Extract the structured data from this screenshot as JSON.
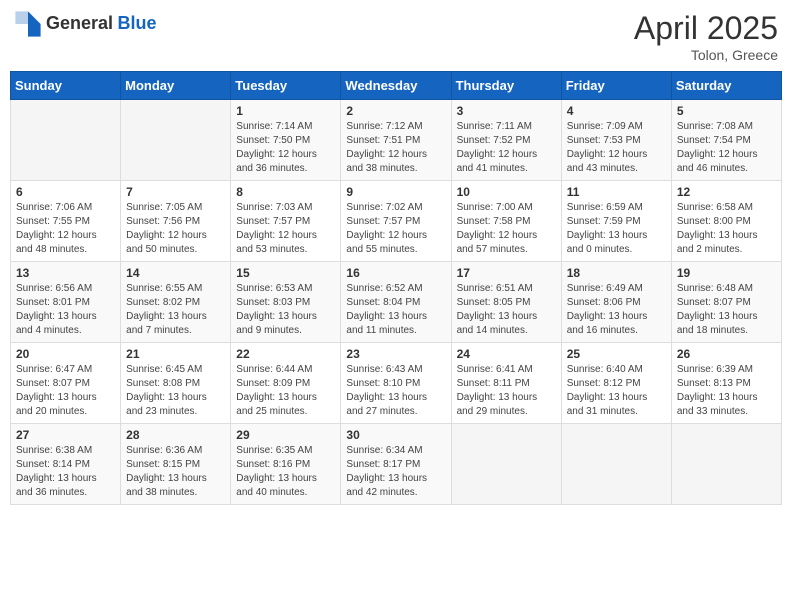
{
  "header": {
    "logo_general": "General",
    "logo_blue": "Blue",
    "month": "April 2025",
    "location": "Tolon, Greece"
  },
  "days_of_week": [
    "Sunday",
    "Monday",
    "Tuesday",
    "Wednesday",
    "Thursday",
    "Friday",
    "Saturday"
  ],
  "weeks": [
    [
      {
        "day": "",
        "sunrise": "",
        "sunset": "",
        "daylight": "",
        "empty": true
      },
      {
        "day": "",
        "sunrise": "",
        "sunset": "",
        "daylight": "",
        "empty": true
      },
      {
        "day": "1",
        "sunrise": "Sunrise: 7:14 AM",
        "sunset": "Sunset: 7:50 PM",
        "daylight": "Daylight: 12 hours and 36 minutes.",
        "empty": false
      },
      {
        "day": "2",
        "sunrise": "Sunrise: 7:12 AM",
        "sunset": "Sunset: 7:51 PM",
        "daylight": "Daylight: 12 hours and 38 minutes.",
        "empty": false
      },
      {
        "day": "3",
        "sunrise": "Sunrise: 7:11 AM",
        "sunset": "Sunset: 7:52 PM",
        "daylight": "Daylight: 12 hours and 41 minutes.",
        "empty": false
      },
      {
        "day": "4",
        "sunrise": "Sunrise: 7:09 AM",
        "sunset": "Sunset: 7:53 PM",
        "daylight": "Daylight: 12 hours and 43 minutes.",
        "empty": false
      },
      {
        "day": "5",
        "sunrise": "Sunrise: 7:08 AM",
        "sunset": "Sunset: 7:54 PM",
        "daylight": "Daylight: 12 hours and 46 minutes.",
        "empty": false
      }
    ],
    [
      {
        "day": "6",
        "sunrise": "Sunrise: 7:06 AM",
        "sunset": "Sunset: 7:55 PM",
        "daylight": "Daylight: 12 hours and 48 minutes.",
        "empty": false
      },
      {
        "day": "7",
        "sunrise": "Sunrise: 7:05 AM",
        "sunset": "Sunset: 7:56 PM",
        "daylight": "Daylight: 12 hours and 50 minutes.",
        "empty": false
      },
      {
        "day": "8",
        "sunrise": "Sunrise: 7:03 AM",
        "sunset": "Sunset: 7:57 PM",
        "daylight": "Daylight: 12 hours and 53 minutes.",
        "empty": false
      },
      {
        "day": "9",
        "sunrise": "Sunrise: 7:02 AM",
        "sunset": "Sunset: 7:57 PM",
        "daylight": "Daylight: 12 hours and 55 minutes.",
        "empty": false
      },
      {
        "day": "10",
        "sunrise": "Sunrise: 7:00 AM",
        "sunset": "Sunset: 7:58 PM",
        "daylight": "Daylight: 12 hours and 57 minutes.",
        "empty": false
      },
      {
        "day": "11",
        "sunrise": "Sunrise: 6:59 AM",
        "sunset": "Sunset: 7:59 PM",
        "daylight": "Daylight: 13 hours and 0 minutes.",
        "empty": false
      },
      {
        "day": "12",
        "sunrise": "Sunrise: 6:58 AM",
        "sunset": "Sunset: 8:00 PM",
        "daylight": "Daylight: 13 hours and 2 minutes.",
        "empty": false
      }
    ],
    [
      {
        "day": "13",
        "sunrise": "Sunrise: 6:56 AM",
        "sunset": "Sunset: 8:01 PM",
        "daylight": "Daylight: 13 hours and 4 minutes.",
        "empty": false
      },
      {
        "day": "14",
        "sunrise": "Sunrise: 6:55 AM",
        "sunset": "Sunset: 8:02 PM",
        "daylight": "Daylight: 13 hours and 7 minutes.",
        "empty": false
      },
      {
        "day": "15",
        "sunrise": "Sunrise: 6:53 AM",
        "sunset": "Sunset: 8:03 PM",
        "daylight": "Daylight: 13 hours and 9 minutes.",
        "empty": false
      },
      {
        "day": "16",
        "sunrise": "Sunrise: 6:52 AM",
        "sunset": "Sunset: 8:04 PM",
        "daylight": "Daylight: 13 hours and 11 minutes.",
        "empty": false
      },
      {
        "day": "17",
        "sunrise": "Sunrise: 6:51 AM",
        "sunset": "Sunset: 8:05 PM",
        "daylight": "Daylight: 13 hours and 14 minutes.",
        "empty": false
      },
      {
        "day": "18",
        "sunrise": "Sunrise: 6:49 AM",
        "sunset": "Sunset: 8:06 PM",
        "daylight": "Daylight: 13 hours and 16 minutes.",
        "empty": false
      },
      {
        "day": "19",
        "sunrise": "Sunrise: 6:48 AM",
        "sunset": "Sunset: 8:07 PM",
        "daylight": "Daylight: 13 hours and 18 minutes.",
        "empty": false
      }
    ],
    [
      {
        "day": "20",
        "sunrise": "Sunrise: 6:47 AM",
        "sunset": "Sunset: 8:07 PM",
        "daylight": "Daylight: 13 hours and 20 minutes.",
        "empty": false
      },
      {
        "day": "21",
        "sunrise": "Sunrise: 6:45 AM",
        "sunset": "Sunset: 8:08 PM",
        "daylight": "Daylight: 13 hours and 23 minutes.",
        "empty": false
      },
      {
        "day": "22",
        "sunrise": "Sunrise: 6:44 AM",
        "sunset": "Sunset: 8:09 PM",
        "daylight": "Daylight: 13 hours and 25 minutes.",
        "empty": false
      },
      {
        "day": "23",
        "sunrise": "Sunrise: 6:43 AM",
        "sunset": "Sunset: 8:10 PM",
        "daylight": "Daylight: 13 hours and 27 minutes.",
        "empty": false
      },
      {
        "day": "24",
        "sunrise": "Sunrise: 6:41 AM",
        "sunset": "Sunset: 8:11 PM",
        "daylight": "Daylight: 13 hours and 29 minutes.",
        "empty": false
      },
      {
        "day": "25",
        "sunrise": "Sunrise: 6:40 AM",
        "sunset": "Sunset: 8:12 PM",
        "daylight": "Daylight: 13 hours and 31 minutes.",
        "empty": false
      },
      {
        "day": "26",
        "sunrise": "Sunrise: 6:39 AM",
        "sunset": "Sunset: 8:13 PM",
        "daylight": "Daylight: 13 hours and 33 minutes.",
        "empty": false
      }
    ],
    [
      {
        "day": "27",
        "sunrise": "Sunrise: 6:38 AM",
        "sunset": "Sunset: 8:14 PM",
        "daylight": "Daylight: 13 hours and 36 minutes.",
        "empty": false
      },
      {
        "day": "28",
        "sunrise": "Sunrise: 6:36 AM",
        "sunset": "Sunset: 8:15 PM",
        "daylight": "Daylight: 13 hours and 38 minutes.",
        "empty": false
      },
      {
        "day": "29",
        "sunrise": "Sunrise: 6:35 AM",
        "sunset": "Sunset: 8:16 PM",
        "daylight": "Daylight: 13 hours and 40 minutes.",
        "empty": false
      },
      {
        "day": "30",
        "sunrise": "Sunrise: 6:34 AM",
        "sunset": "Sunset: 8:17 PM",
        "daylight": "Daylight: 13 hours and 42 minutes.",
        "empty": false
      },
      {
        "day": "",
        "sunrise": "",
        "sunset": "",
        "daylight": "",
        "empty": true
      },
      {
        "day": "",
        "sunrise": "",
        "sunset": "",
        "daylight": "",
        "empty": true
      },
      {
        "day": "",
        "sunrise": "",
        "sunset": "",
        "daylight": "",
        "empty": true
      }
    ]
  ]
}
